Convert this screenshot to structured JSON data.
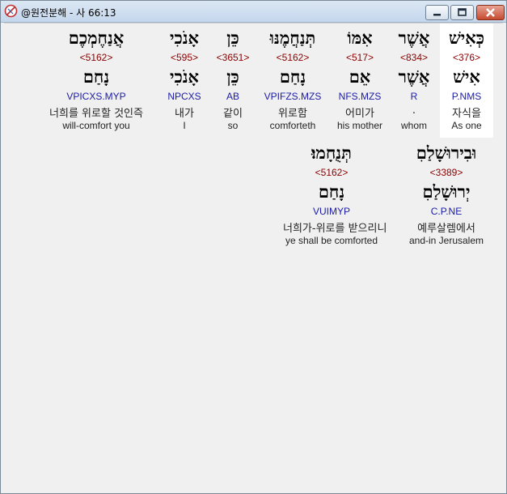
{
  "window": {
    "title": "@원전분해 - 사 66:13"
  },
  "rows": [
    {
      "words": [
        {
          "heb": "כְּאִישׁ",
          "strong": "<376>",
          "lemma": "אִישׁ",
          "parse": "P.NMS",
          "ko": "자식을",
          "en": "As one"
        },
        {
          "heb": "אֲשֶׁר",
          "strong": "<834>",
          "lemma": "אֲשֶׁר",
          "parse": "R",
          "ko": ".",
          "en": "whom"
        },
        {
          "heb": "אִמּוֹ",
          "strong": "<517>",
          "lemma": "אֵם",
          "parse": "NFS.MZS",
          "ko": "어미가",
          "en": "his mother"
        },
        {
          "heb": "תְּנַחֲמֶנּוּ",
          "strong": "<5162>",
          "lemma": "נָחַם",
          "parse": "VPIFZS.MZS",
          "ko": "위로함",
          "en": "comforteth"
        },
        {
          "heb": "כֵּן",
          "strong": "<3651>",
          "lemma": "כֵּן",
          "parse": "AB",
          "ko": "같이",
          "en": "so"
        },
        {
          "heb": "אָנֹכִי",
          "strong": "<595>",
          "lemma": "אָנֹכִי",
          "parse": "NPCXS",
          "ko": "내가",
          "en": "I"
        },
        {
          "heb": "אֲנַחֶמְכֶם",
          "strong": "<5162>",
          "lemma": "נָחַם",
          "parse": "VPICXS.MYP",
          "ko": "너희를 위로할 것인즉",
          "en": "will-comfort you"
        }
      ]
    },
    {
      "words": [
        {
          "heb": "וּבִירוּשָׁלַםִ",
          "strong": "<3389>",
          "lemma": "יְרוּשָׁלַםִ",
          "parse": "C.P.NE",
          "ko": "예루살렘에서",
          "en": "and-in Jerusalem"
        },
        {
          "heb": "תְּנֻחָמוּ׃",
          "strong": "<5162>",
          "lemma": "נָחַם",
          "parse": "VUIMYP",
          "ko": "너희가-위로를 받으리니",
          "en": "ye shall be comforted"
        }
      ]
    }
  ]
}
